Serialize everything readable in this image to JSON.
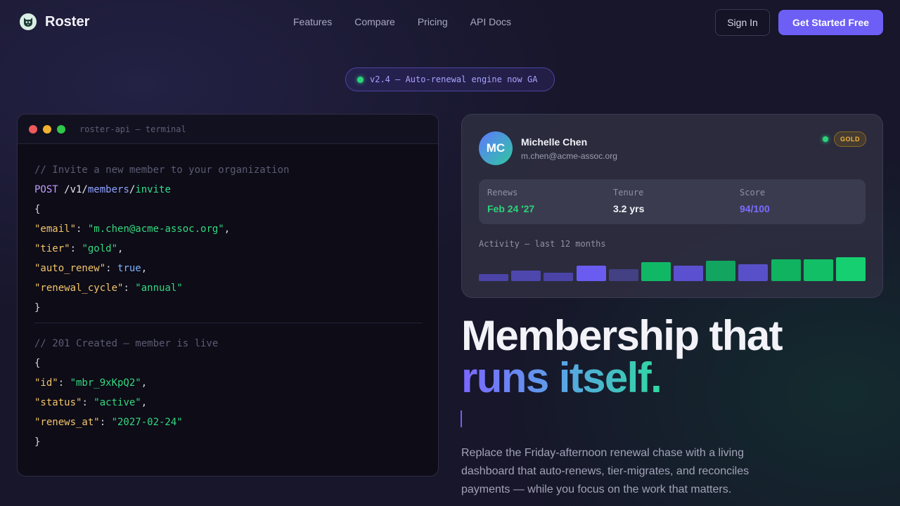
{
  "nav": {
    "brand": "Roster",
    "links": [
      "Features",
      "Compare",
      "Pricing",
      "API Docs"
    ],
    "sign_in": "Sign In",
    "get_started": "Get Started Free"
  },
  "announcement": {
    "text": "v2.4 — Auto-renewal engine now GA",
    "status_color": "#2bd47a"
  },
  "terminal": {
    "title": "roster-api — terminal",
    "request": {
      "comment": "// Invite a new member to your organization",
      "method": "POST",
      "path_root": " /v1/",
      "path_resource": "members",
      "path_sep": "/",
      "path_action": "invite",
      "open": "{",
      "fields": [
        {
          "key": "\"email\"",
          "value": "\"m.chen@acme-assoc.org\"",
          "type": "string",
          "trail": ","
        },
        {
          "key": "\"tier\"",
          "value": "\"gold\"",
          "type": "string",
          "trail": ","
        },
        {
          "key": "\"auto_renew\"",
          "value": "true",
          "type": "bool",
          "trail": ","
        },
        {
          "key": "\"renewal_cycle\"",
          "value": "\"annual\"",
          "type": "string",
          "trail": ""
        }
      ],
      "close": "}"
    },
    "response": {
      "comment": "// 201 Created — member is live",
      "open": "{",
      "fields": [
        {
          "key": "\"id\"",
          "value": "\"mbr_9xKpQ2\"",
          "type": "string",
          "trail": ","
        },
        {
          "key": "\"status\"",
          "value": "\"active\"",
          "type": "string",
          "trail": ","
        },
        {
          "key": "\"renews_at\"",
          "value": "\"2027-02-24\"",
          "type": "string",
          "trail": ""
        }
      ],
      "close": "}"
    }
  },
  "member_card": {
    "initials": "MC",
    "name": "Michelle Chen",
    "email": "m.chen@acme-assoc.org",
    "tier": "GOLD",
    "stats": [
      {
        "label": "Renews",
        "value": "Feb 24 '27",
        "color": "#2bd47a"
      },
      {
        "label": "Tenure",
        "value": "3.2 yrs",
        "color": "#f2f2f8"
      },
      {
        "label": "Score",
        "value": "94/100",
        "color": "#7a6cff"
      }
    ],
    "activity_label": "Activity — last 12 months",
    "activity": [
      {
        "level": 0.3,
        "color": "#4b44a6"
      },
      {
        "level": 0.45,
        "color": "#4e47ad"
      },
      {
        "level": 0.35,
        "color": "#4b44a6"
      },
      {
        "level": 0.65,
        "color": "#6a5cf0"
      },
      {
        "level": 0.5,
        "color": "#434083"
      },
      {
        "level": 0.78,
        "color": "#10b866"
      },
      {
        "level": 0.65,
        "color": "#5b50cf"
      },
      {
        "level": 0.85,
        "color": "#12a560"
      },
      {
        "level": 0.72,
        "color": "#5850c8"
      },
      {
        "level": 0.92,
        "color": "#10b35f"
      },
      {
        "level": 0.9,
        "color": "#12bf66"
      },
      {
        "level": 1.0,
        "color": "#16cf70"
      }
    ]
  },
  "hero": {
    "headline_1": "Membership that",
    "headline_2": "runs itself.",
    "description": "Replace the Friday-afternoon renewal chase with a living dashboard that auto-renews, tier-migrates, and reconciles payments — while you focus on the work that matters."
  }
}
